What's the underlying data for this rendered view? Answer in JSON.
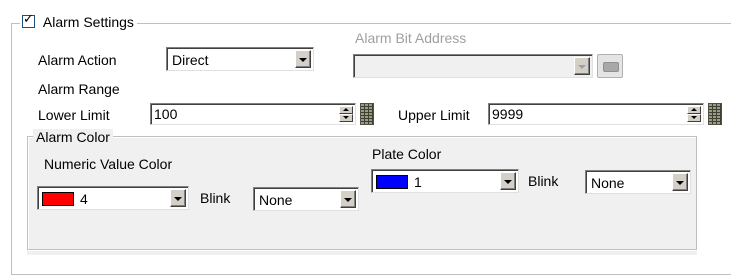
{
  "alarm_settings": {
    "title": "Alarm Settings",
    "checked": true,
    "check_glyph": "✓",
    "alarm_action": {
      "label": "Alarm Action",
      "value": "Direct"
    },
    "alarm_bit_address": {
      "label": "Alarm Bit Address",
      "value": "",
      "enabled": false,
      "icon": "address-input-icon"
    },
    "alarm_range": {
      "label": "Alarm Range",
      "lower_limit": {
        "label": "Lower Limit",
        "value": "100",
        "icon": "keypad-icon"
      },
      "upper_limit": {
        "label": "Upper Limit",
        "value": "9999",
        "icon": "keypad-icon"
      }
    },
    "alarm_color": {
      "title": "Alarm Color",
      "numeric_value_color": {
        "label": "Numeric Value Color",
        "value": "4",
        "swatch_color": "#ff0000",
        "blink_label": "Blink",
        "blink_value": "None"
      },
      "plate_color": {
        "label": "Plate Color",
        "value": "1",
        "swatch_color": "#0000ff",
        "blink_label": "Blink",
        "blink_value": "None"
      }
    }
  }
}
